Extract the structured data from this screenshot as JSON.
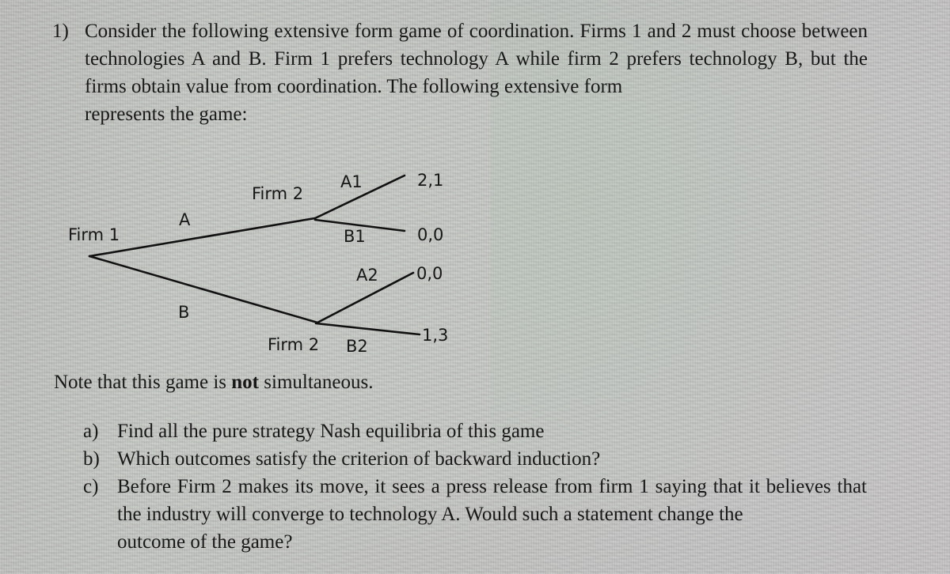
{
  "question": {
    "number": "1)",
    "lines": [
      "Consider the following extensive form game of coordination. Firms 1 and 2 must choose",
      "between technologies A and B. Firm 1 prefers technology A while firm 2 prefers",
      "technology B, but the firms obtain value from coordination. The following extensive form",
      "represents the game:"
    ]
  },
  "diagram": {
    "type": "extensive-form-game-tree",
    "root_player_label": "Firm 1",
    "upper_node_player_label": "Firm 2",
    "lower_node_player_label": "Firm 2",
    "branch_a_label": "A",
    "branch_b_label": "B",
    "branch_a1_label": "A1",
    "branch_b1_label": "B1",
    "branch_a2_label": "A2",
    "branch_b2_label": "B2",
    "payoff_a1": "2,1",
    "payoff_b1": "0,0",
    "payoff_a2": "0,0",
    "payoff_b2": "1,3",
    "line_color": "#111111"
  },
  "note": {
    "before": "Note that this game is ",
    "bold": "not",
    "after": " simultaneous."
  },
  "subquestions": [
    {
      "marker": "a)",
      "lines": [
        "Find all the pure strategy Nash equilibria of this game"
      ]
    },
    {
      "marker": "b)",
      "lines": [
        "Which outcomes satisfy the criterion of backward induction?"
      ]
    },
    {
      "marker": "c)",
      "lines": [
        "Before Firm 2 makes its move, it sees a press release from firm 1 saying that it believes",
        "that the industry will converge to technology A. Would such a statement change the",
        "outcome of the game?"
      ]
    }
  ]
}
